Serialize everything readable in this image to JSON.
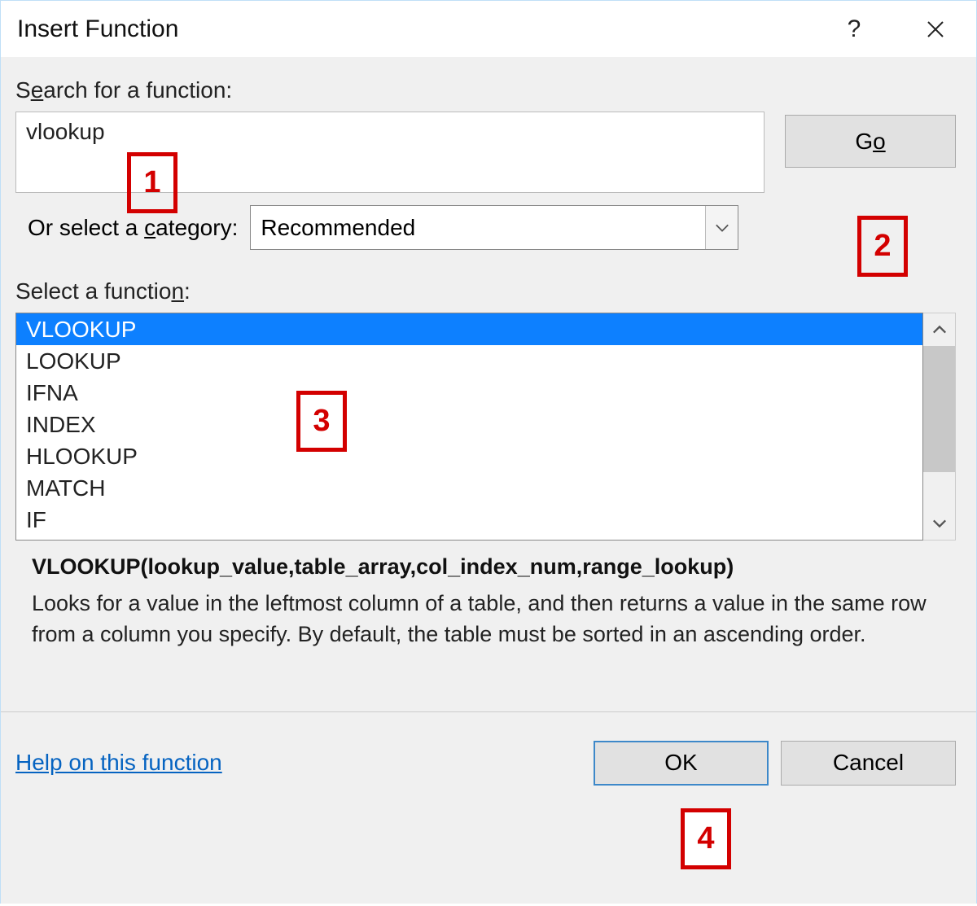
{
  "titlebar": {
    "title": "Insert Function",
    "help": "?",
    "close": "✕"
  },
  "search": {
    "label_pre": "S",
    "label_u": "e",
    "label_post": "arch for a function:",
    "value": "vlookup",
    "go_pre": "G",
    "go_u": "o"
  },
  "category": {
    "label_pre": "Or select a ",
    "label_u": "c",
    "label_post": "ategory:",
    "selected": "Recommended"
  },
  "select": {
    "label_pre": "Select a functio",
    "label_u": "n",
    "label_post": ":"
  },
  "functions": [
    "VLOOKUP",
    "LOOKUP",
    "IFNA",
    "INDEX",
    "HLOOKUP",
    "MATCH",
    "IF"
  ],
  "details": {
    "signature": "VLOOKUP(lookup_value,table_array,col_index_num,range_lookup)",
    "description": "Looks for a value in the leftmost column of a table, and then returns a value in the same row from a column you specify. By default, the table must be sorted in an ascending order."
  },
  "footer": {
    "help_link": "Help on this function",
    "ok": "OK",
    "cancel": "Cancel"
  },
  "annotations": {
    "a1": "1",
    "a2": "2",
    "a3": "3",
    "a4": "4"
  }
}
